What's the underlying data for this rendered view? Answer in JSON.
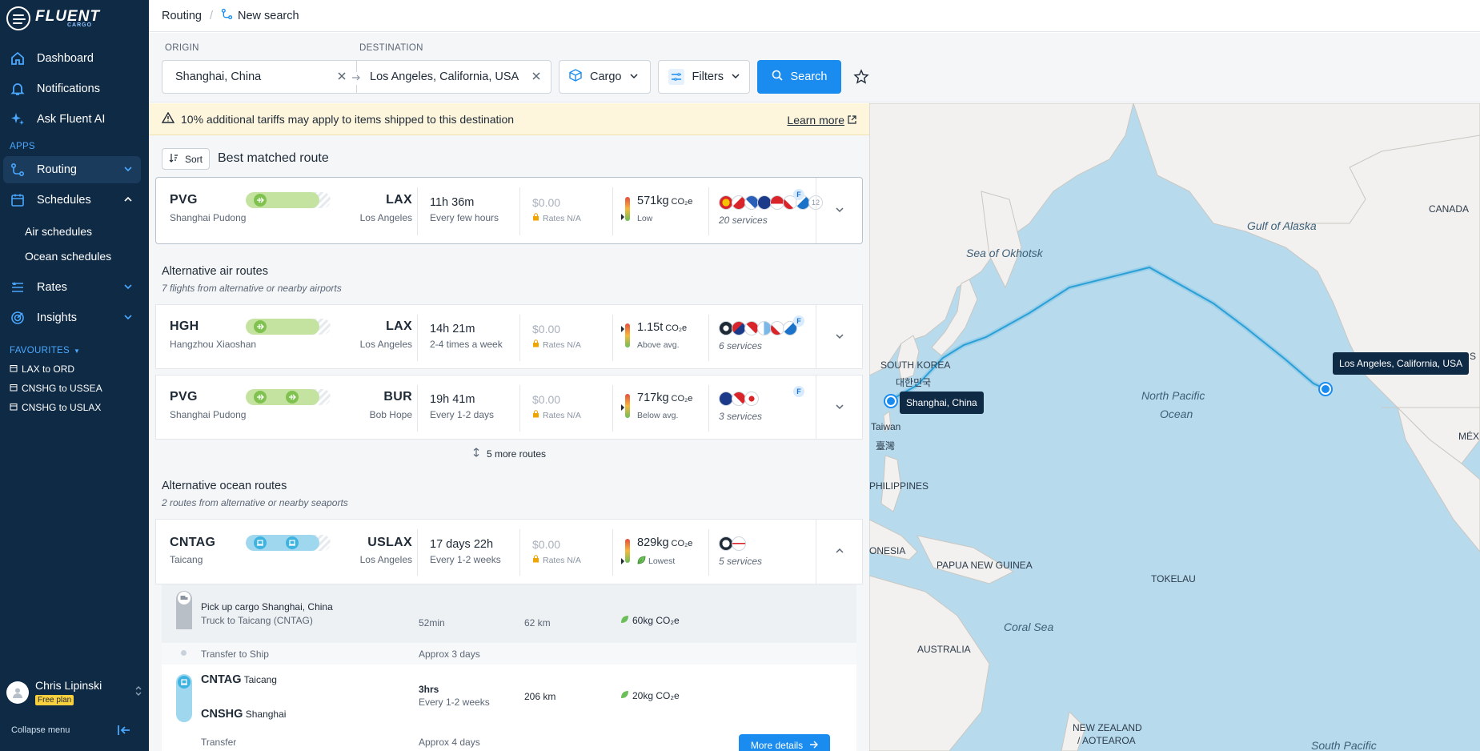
{
  "app": {
    "logo_text": "FLUENT",
    "logo_sub": "CARGO"
  },
  "sidebar": {
    "items": [
      {
        "label": "Dashboard",
        "icon": "home-icon"
      },
      {
        "label": "Notifications",
        "icon": "bell-icon"
      },
      {
        "label": "Ask Fluent AI",
        "icon": "sparkle-icon"
      }
    ],
    "apps_label": "APPS",
    "apps": [
      {
        "label": "Routing",
        "icon": "routing-icon"
      },
      {
        "label": "Schedules",
        "icon": "calendar-icon"
      },
      {
        "label": "Rates",
        "icon": "rates-icon"
      },
      {
        "label": "Insights",
        "icon": "insights-icon"
      }
    ],
    "schedules_sub": [
      "Air schedules",
      "Ocean schedules"
    ],
    "favourites_label": "FAVOURITES",
    "favourites": [
      "LAX to ORD",
      "CNSHG to USSEA",
      "CNSHG to USLAX"
    ],
    "user": {
      "name": "Chris Lipinski",
      "plan": "Free plan"
    },
    "collapse_label": "Collapse menu"
  },
  "breadcrumb": {
    "root": "Routing",
    "current": "New search"
  },
  "search": {
    "origin_label": "ORIGIN",
    "origin_value": "Shanghai, China",
    "destination_label": "DESTINATION",
    "destination_value": "Los Angeles, California, USA",
    "cargo_label": "Cargo",
    "filters_label": "Filters",
    "search_label": "Search"
  },
  "warning": {
    "text": "10% additional tariffs may apply to items shipped to this destination",
    "link": "Learn more"
  },
  "results": {
    "sort_label": "Sort",
    "best_title": "Best matched route",
    "best": {
      "origin": "PVG",
      "origin_name": "Shanghai Pudong",
      "dest": "LAX",
      "dest_name": "Los Angeles",
      "duration": "11h 36m",
      "frequency": "Every few hours",
      "price": "$0.00",
      "rates": "Rates N/A",
      "emissions": "571kg",
      "co2": "CO₂e",
      "level": "Low",
      "services": "20 services",
      "more_count": "12",
      "badge": "F"
    },
    "air_title": "Alternative air routes",
    "air_sub": "7 flights from alternative or nearby airports",
    "air": [
      {
        "origin": "HGH",
        "origin_name": "Hangzhou Xiaoshan",
        "dest": "LAX",
        "dest_name": "Los Angeles",
        "duration": "14h 21m",
        "frequency": "2-4 times a week",
        "price": "$0.00",
        "rates": "Rates N/A",
        "emissions": "1.15t",
        "co2": "CO₂e",
        "level": "Above avg.",
        "services": "6 services",
        "badge": "F"
      },
      {
        "origin": "PVG",
        "origin_name": "Shanghai Pudong",
        "dest": "BUR",
        "dest_name": "Bob Hope",
        "duration": "19h 41m",
        "frequency": "Every 1-2 days",
        "price": "$0.00",
        "rates": "Rates N/A",
        "emissions": "717kg",
        "co2": "CO₂e",
        "level": "Below avg.",
        "services": "3 services",
        "badge": "F"
      }
    ],
    "more_routes": "5 more routes",
    "ocean_title": "Alternative ocean routes",
    "ocean_sub": "2 routes from alternative or nearby seaports",
    "ocean": {
      "origin": "CNTAG",
      "origin_name": "Taicang",
      "dest": "USLAX",
      "dest_name": "Los Angeles",
      "duration": "17 days 22h",
      "frequency": "Every 1-2 weeks",
      "price": "$0.00",
      "rates": "Rates N/A",
      "emissions": "829kg",
      "co2": "CO₂e",
      "level": "Lowest",
      "services": "5 services"
    },
    "legs": {
      "pickup_title": "Pick up cargo Shanghai, China",
      "pickup_sub": "Truck to Taicang (CNTAG)",
      "pickup_time": "52min",
      "pickup_dist": "62 km",
      "pickup_emis": "60kg CO₂e",
      "transfer1": "Transfer to Ship",
      "transfer1_time": "Approx 3 days",
      "ship_from_code": "CNTAG",
      "ship_from_name": "Taicang",
      "ship_to_code": "CNSHG",
      "ship_to_name": "Shanghai",
      "ship_time": "3hrs",
      "ship_freq": "Every 1-2 weeks",
      "ship_dist": "206 km",
      "ship_emis": "20kg CO₂e",
      "transfer2": "Transfer",
      "transfer2_time": "Approx 4 days",
      "more_details": "More details"
    }
  },
  "map": {
    "labels": [
      "CANADA",
      "Gulf of Alaska",
      "Sea of Okhotsk",
      "SOUTH KOREA",
      "대한민국",
      "Taiwan",
      "臺灣",
      "PHILIPPINES",
      "ONESIA",
      "PAPUA NEW GUINEA",
      "TOKELAU",
      "AUSTRALIA",
      "NEW ZEALAND",
      "/ AOTEAROA",
      "MÉXIC",
      "S"
    ],
    "oceans": [
      "North Pacific",
      "Ocean",
      "Coral Sea",
      "South Pacific"
    ],
    "origin_tip": "Shanghai, China",
    "dest_tip": "Los Angeles, California, USA"
  },
  "colors": {
    "sidebar": "#0f2a44",
    "accent": "#1a8cf0",
    "air_track": "#c5e3a0",
    "ocean_track": "#9fd7ef",
    "map_water": "#b7dbed",
    "map_land": "#f2f1ef"
  }
}
